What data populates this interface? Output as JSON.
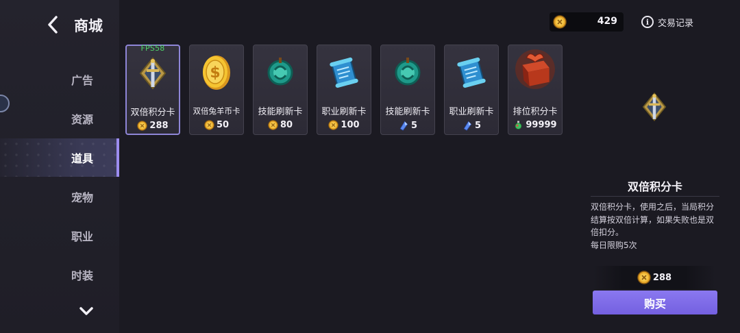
{
  "header": {
    "title": "商城",
    "currency_amount": "429",
    "history_label": "交易记录"
  },
  "sidebar": {
    "items": [
      {
        "label": "广告"
      },
      {
        "label": "资源"
      },
      {
        "label": "道具"
      },
      {
        "label": "宠物"
      },
      {
        "label": "职业"
      },
      {
        "label": "时装"
      }
    ],
    "active_index": 2
  },
  "overlay": {
    "fps": "FPS58"
  },
  "items": [
    {
      "name": "双倍积分卡",
      "price": "288",
      "currency": "gold-coin",
      "icon": "sword-emblem-icon"
    },
    {
      "name": "双倍兔羊币卡",
      "price": "50",
      "currency": "gold-coin",
      "icon": "gold-coin-icon"
    },
    {
      "name": "技能刷新卡",
      "price": "80",
      "currency": "gold-coin",
      "icon": "jade-refresh-icon"
    },
    {
      "name": "职业刷新卡",
      "price": "100",
      "currency": "gold-coin",
      "icon": "blue-scroll-icon"
    },
    {
      "name": "技能刷新卡",
      "price": "5",
      "currency": "crystal",
      "icon": "jade-refresh-icon"
    },
    {
      "name": "职业刷新卡",
      "price": "5",
      "currency": "crystal",
      "icon": "blue-scroll-icon"
    },
    {
      "name": "排位积分卡",
      "price": "99999",
      "currency": "potion",
      "icon": "red-gift-box-icon"
    }
  ],
  "detail": {
    "name": "双倍积分卡",
    "description": "双倍积分卡，使用之后，当局积分结算按双倍计算，如果失败也是双倍扣分。",
    "limit": "每日限购5次",
    "price": "288",
    "buy_label": "购买"
  },
  "colors": {
    "accent": "#8a78f0",
    "fps_text": "#4fd56a",
    "background": "#1b1a22"
  }
}
